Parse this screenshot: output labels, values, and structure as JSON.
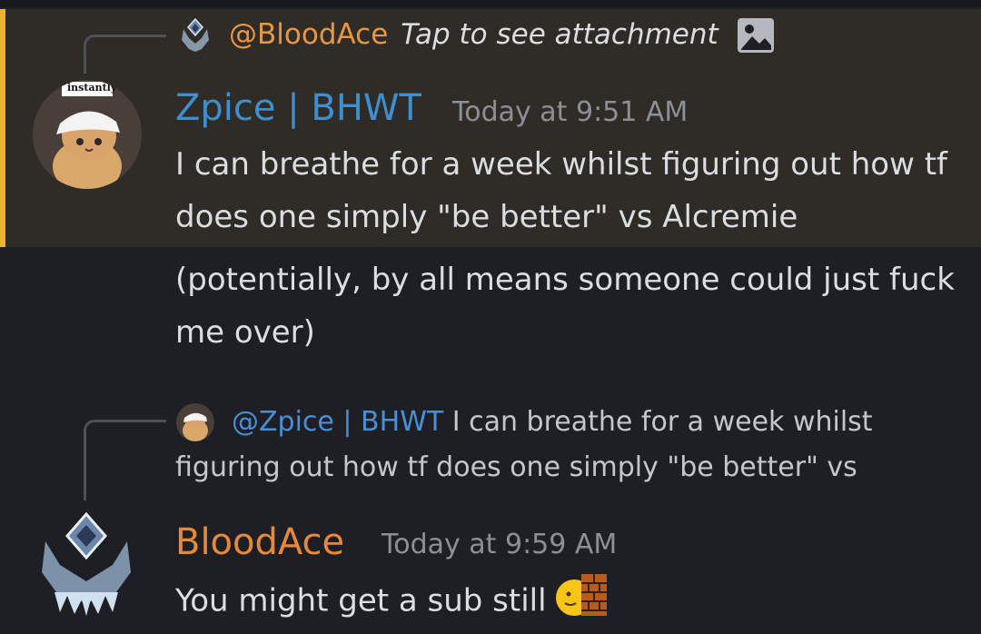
{
  "messages": [
    {
      "reply_to": {
        "mention": "@BloodAce",
        "preview": "Tap to see attachment",
        "attachment_icon": "image-icon"
      },
      "author": "Zpice | BHWT",
      "author_color": "#3f8ed0",
      "timestamp": "Today at 9:51 AM",
      "avatar_caption": "instantly",
      "lines": [
        "I can breathe for a week whilst figuring out how tf does one simply \"be better\" vs Alcremie",
        "(potentially, by all means someone could just fuck me over)"
      ],
      "highlight_color": "#f0b232"
    },
    {
      "reply_to": {
        "mention": "@Zpice | BHWT",
        "preview": "I can breathe for a week whilst figuring out how tf does one simply \"be better\" vs"
      },
      "author": "BloodAce",
      "author_color": "#e8893a",
      "timestamp": "Today at 9:59 AM",
      "text": "You might get a sub still",
      "emoji": "melting-face-brick-wall-emoji"
    }
  ]
}
